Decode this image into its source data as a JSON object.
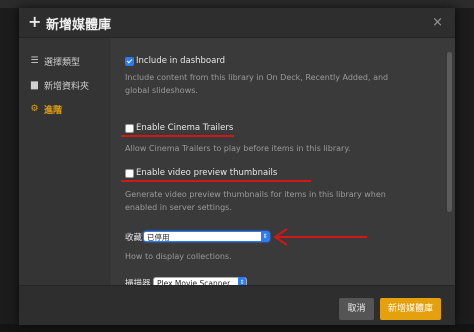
{
  "dialog": {
    "title": "新增媒體庫",
    "close_glyph": "×",
    "plus_glyph": "+"
  },
  "sidebar": {
    "items": [
      {
        "label": "選擇類型",
        "icon": "list-icon",
        "glyph": "☰"
      },
      {
        "label": "新增資料夾",
        "icon": "folder-icon",
        "glyph": "▆"
      },
      {
        "label": "進階",
        "icon": "gear-icon",
        "glyph": "⚙",
        "active": true
      }
    ]
  },
  "options": {
    "include_dashboard": {
      "label": "Include in dashboard",
      "checked": true,
      "help": "Include content from this library in On Deck, Recently Added, and global slideshows."
    },
    "cinema_trailers": {
      "label": "Enable Cinema Trailers",
      "checked": false,
      "help": "Allow Cinema Trailers to play before items in this library."
    },
    "video_preview": {
      "label": "Enable video preview thumbnails",
      "checked": false,
      "help": "Generate video preview thumbnails for items in this library when enabled in server settings."
    },
    "collections": {
      "label": "收藏",
      "value": "已停用",
      "help": "How to display collections."
    },
    "scanner": {
      "label": "掃描器",
      "value": "Plex Movie Scanner"
    }
  },
  "footer": {
    "cancel_label": "取消",
    "add_label": "新增媒體庫"
  },
  "colors": {
    "accent": "#e5a00d",
    "checkbox_blue": "#2b7bf2",
    "annotation_red": "#d01818"
  }
}
